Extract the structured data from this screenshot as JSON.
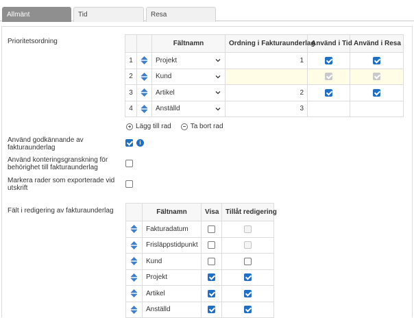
{
  "tabs": [
    {
      "label": "Allmänt",
      "active": true
    },
    {
      "label": "Tid",
      "active": false
    },
    {
      "label": "Resa",
      "active": false
    }
  ],
  "labels": {
    "prioritet": "Prioritetsordning",
    "godkannande": "Använd godkännande av fakturaunderlag",
    "kontering": "Använd konteringsgranskning för behörighet till fakturaunderlag",
    "markera": "Markera rader som exporterade vid utskrift",
    "falt": "Fält i redigering av fakturaunderlag"
  },
  "priority_table": {
    "headers": [
      "Fältnamn",
      "Ordning i Fakturaunderlag",
      "Använd i Tid",
      "Använd i Resa"
    ],
    "rows": [
      {
        "num": "1",
        "field": "Projekt",
        "order": "1",
        "tid": "checked",
        "resa": "checked"
      },
      {
        "num": "2",
        "field": "Kund",
        "order": "",
        "tid": "disabled-checked",
        "resa": "disabled-checked"
      },
      {
        "num": "3",
        "field": "Artikel",
        "order": "2",
        "tid": "checked",
        "resa": "checked"
      },
      {
        "num": "4",
        "field": "Anställd",
        "order": "3",
        "tid": "none",
        "resa": "none"
      }
    ]
  },
  "row_actions": {
    "add": "Lägg till rad",
    "remove": "Ta bort rad"
  },
  "options": {
    "godkannande": true,
    "kontering": false,
    "markera": false
  },
  "edit_table": {
    "headers": [
      "Fältnamn",
      "Visa",
      "Tillåt redigering"
    ],
    "rows": [
      {
        "field": "Fakturadatum",
        "visa": "unchecked",
        "edit": "disabled"
      },
      {
        "field": "Frisläppstidpunkt",
        "visa": "unchecked",
        "edit": "disabled"
      },
      {
        "field": "Kund",
        "visa": "unchecked",
        "edit": "unchecked"
      },
      {
        "field": "Projekt",
        "visa": "checked",
        "edit": "checked"
      },
      {
        "field": "Artikel",
        "visa": "checked",
        "edit": "checked"
      },
      {
        "field": "Anställd",
        "visa": "checked",
        "edit": "checked"
      }
    ]
  },
  "icons": {
    "drag": "drag-arrows-icon",
    "chevron": "chevron-down-icon",
    "info": "info-icon",
    "add": "plus-circle-icon",
    "remove": "minus-circle-icon"
  },
  "colors": {
    "accent": "#1f6fc5",
    "active_tab": "#8f8f8f",
    "highlight_row": "#fffde6"
  }
}
